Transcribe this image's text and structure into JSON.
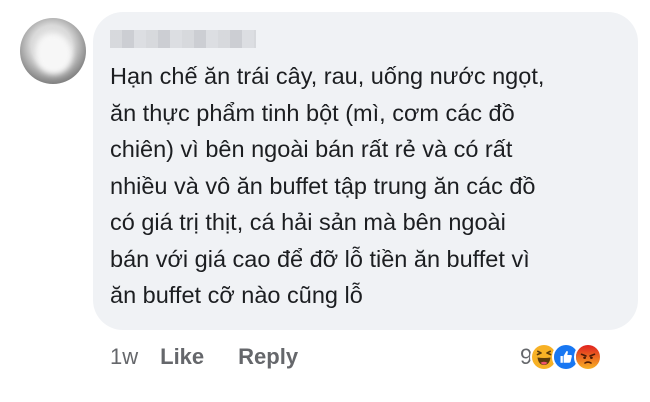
{
  "comment": {
    "author_name": "",
    "text_lines": [
      "Hạn chế ăn trái cây, rau, uống nước ngọt,",
      "ăn thực phẩm tinh bột (mì, cơm các đồ",
      "chiên) vì bên ngoài bán rất rẻ và có rất",
      "nhiều và vô ăn buffet tập trung ăn các đồ",
      "có giá trị thịt, cá hải sản mà bên ngoài",
      "bán với giá cao để đỡ lỗ tiền ăn buffet vì",
      "ăn buffet cỡ nào cũng lỗ"
    ]
  },
  "actions": {
    "time": "1w",
    "like_label": "Like",
    "reply_label": "Reply"
  },
  "reactions": {
    "count": "9",
    "icons": [
      "haha-icon",
      "like-icon",
      "angry-icon"
    ]
  },
  "colors": {
    "bubble": "#f0f2f5",
    "text": "#1c1e21",
    "meta": "#65676b",
    "like_blue": "#1877f2",
    "haha_yellow": "#f7b125",
    "angry_orange": "#e9710f"
  }
}
